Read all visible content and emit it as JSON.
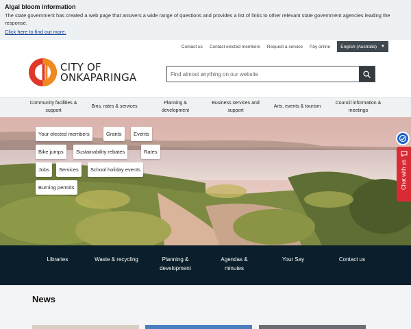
{
  "alert": {
    "title": "Algal bloom information",
    "body": "The state government has created a web page that answers a wide range of questions and provides a list of links to other relevant state government agencies leading the response.",
    "link": "Click here to find out more."
  },
  "utility": {
    "links": [
      "Contact us",
      "Contact elected members",
      "Request a service",
      "Pay online"
    ],
    "language": "English (Australia)"
  },
  "logo": {
    "line1": "CITY OF",
    "line2": "ONKAPARINGA"
  },
  "search": {
    "placeholder": "Find almost anything on our website"
  },
  "nav": [
    "Community facilities & support",
    "Bins, rates & services",
    "Planning & development",
    "Business services and support",
    "Arts, events & tourism",
    "Council information & meetings"
  ],
  "tags": [
    "Your elected members",
    "Grants",
    "Events",
    "Bike jumps",
    "Sustainability rebates",
    "Rates",
    "Jobs",
    "Services",
    "School holiday events",
    "Burning permits"
  ],
  "chat": {
    "label": "Chat with us"
  },
  "quick_links": [
    "Libraries",
    "Waste & recycling",
    "Planning & development",
    "Agendas & minutes",
    "Your Say",
    "Contact us"
  ],
  "news": {
    "title": "News"
  },
  "colors": {
    "brand_red": "#e0372b",
    "brand_orange": "#f08a1f",
    "dark_navy": "#0a1f2b",
    "chat_red": "#d92b34",
    "badge_blue": "#1b61c9"
  }
}
